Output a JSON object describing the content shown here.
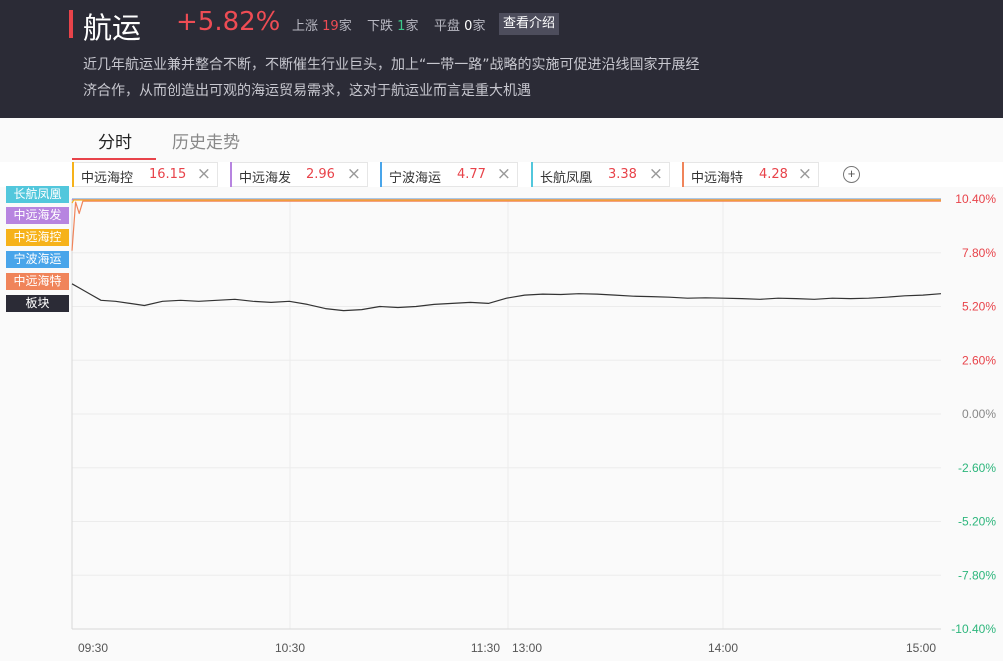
{
  "header": {
    "title": "航运",
    "change_pct": "+5.82%",
    "up_label": "上涨",
    "up_count": "19",
    "down_label": "下跌",
    "down_count": "1",
    "flat_label": "平盘",
    "flat_count": "0",
    "unit": "家",
    "intro_button": "查看介绍",
    "description_line1": "近几年航运业兼并整合不断，不断催生行业巨头，加上“一带一路”战略的实施可促进沿线国家开展经",
    "description_line2": "济合作，从而创造出可观的海运贸易需求，这对于航运业而言是重大机遇"
  },
  "tabs": [
    {
      "label": "分时",
      "active": true
    },
    {
      "label": "历史走势",
      "active": false
    }
  ],
  "chips": [
    {
      "name": "中远海控",
      "value": "16.15",
      "color": "#f6b21a"
    },
    {
      "name": "中远海发",
      "value": "2.96",
      "color": "#b784e0"
    },
    {
      "name": "宁波海运",
      "value": "4.77",
      "color": "#49a5ea"
    },
    {
      "name": "长航凤凰",
      "value": "3.38",
      "color": "#52c7dc"
    },
    {
      "name": "中远海特",
      "value": "4.28",
      "color": "#f0845a"
    }
  ],
  "chip_close_glyph": "×",
  "add_glyph": "+",
  "legend": [
    {
      "label": "长航凤凰",
      "color": "#52c7dc"
    },
    {
      "label": "中远海发",
      "color": "#b784e0"
    },
    {
      "label": "中远海控",
      "color": "#f6b21a"
    },
    {
      "label": "宁波海运",
      "color": "#49a5ea"
    },
    {
      "label": "中远海特",
      "color": "#f0845a"
    },
    {
      "label": "板块",
      "color": "#2b2b36"
    }
  ],
  "chart_data": {
    "type": "line",
    "x_ticks": [
      "09:30",
      "10:30",
      "11:30",
      "13:00",
      "14:00",
      "15:00"
    ],
    "y_ticks": [
      "10.40%",
      "7.80%",
      "5.20%",
      "2.60%",
      "0.00%",
      "-2.60%",
      "-5.20%",
      "-7.80%",
      "-10.40%"
    ],
    "ylim": [
      -10.4,
      10.4
    ],
    "x_minutes": [
      0,
      240
    ],
    "up_color": "#e8434a",
    "down_color": "#2db67c",
    "zero_color": "#888888",
    "grid": true,
    "series": [
      {
        "name": "板块",
        "color": "#333333",
        "x": [
          0,
          2,
          5,
          8,
          12,
          16,
          20,
          25,
          30,
          35,
          40,
          45,
          50,
          55,
          60,
          65,
          70,
          75,
          80,
          85,
          90,
          95,
          100,
          105,
          110,
          115,
          120,
          125,
          130,
          135,
          140,
          145,
          150,
          155,
          160,
          165,
          170,
          175,
          180,
          185,
          190,
          195,
          200,
          205,
          210,
          215,
          220,
          225,
          230,
          235,
          240
        ],
        "y": [
          6.3,
          6.1,
          5.8,
          5.5,
          5.45,
          5.35,
          5.25,
          5.45,
          5.5,
          5.45,
          5.5,
          5.55,
          5.45,
          5.4,
          5.45,
          5.3,
          5.1,
          5.0,
          5.05,
          5.2,
          5.15,
          5.2,
          5.3,
          5.35,
          5.4,
          5.35,
          5.6,
          5.75,
          5.8,
          5.78,
          5.82,
          5.8,
          5.75,
          5.7,
          5.68,
          5.65,
          5.6,
          5.62,
          5.6,
          5.58,
          5.55,
          5.6,
          5.58,
          5.55,
          5.6,
          5.58,
          5.6,
          5.65,
          5.72,
          5.75,
          5.82
        ]
      },
      {
        "name": "中远海特",
        "color": "#f0845a",
        "x": [
          0,
          1,
          2,
          3,
          4,
          240
        ],
        "y": [
          7.9,
          10.25,
          9.7,
          10.3,
          10.3,
          10.3
        ]
      },
      {
        "name": "中远海控",
        "color": "#f6b21a",
        "x": [
          0,
          0.5,
          240
        ],
        "y": [
          10.2,
          10.35,
          10.35
        ]
      },
      {
        "name": "中远海发",
        "color": "#b784e0",
        "x": [
          0,
          240
        ],
        "y": [
          10.38,
          10.38
        ]
      },
      {
        "name": "宁波海运",
        "color": "#49a5ea",
        "x": [
          0,
          240
        ],
        "y": [
          10.36,
          10.36
        ]
      },
      {
        "name": "长航凤凰",
        "color": "#52c7dc",
        "x": [
          0,
          240
        ],
        "y": [
          10.4,
          10.4
        ]
      }
    ]
  }
}
